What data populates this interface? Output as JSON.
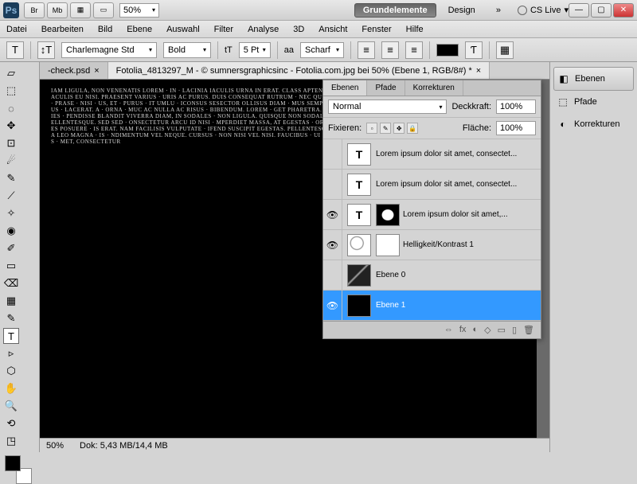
{
  "titlebar": {
    "app_abbrev": "Ps",
    "toolbar_buttons": [
      "Br",
      "Mb",
      "▦",
      "▭"
    ],
    "zoom": "50%",
    "workspaces": [
      {
        "label": "Grundelemente",
        "active": true
      },
      {
        "label": "Design",
        "active": false
      }
    ],
    "more": "»",
    "cslive": "CS Live"
  },
  "menubar": [
    "Datei",
    "Bearbeiten",
    "Bild",
    "Ebene",
    "Auswahl",
    "Filter",
    "Analyse",
    "3D",
    "Ansicht",
    "Fenster",
    "Hilfe"
  ],
  "optbar": {
    "tool": "T",
    "font_family": "Charlemagne Std",
    "font_weight": "Bold",
    "size_icon": "tT",
    "font_size": "5 Pt",
    "aa_label": "aa",
    "aa_mode": "Scharf",
    "color": "#000000"
  },
  "doc_tabs": [
    {
      "label": "-check.psd",
      "close": "×",
      "active": false
    },
    {
      "label": "Fotolia_4813297_M - © sumnersgraphicsinc - Fotolia.com.jpg bei 50% (Ebene 1, RGB/8#) *",
      "close": "×",
      "active": true
    }
  ],
  "canvas_text": "IAM LIGULA, NON VENENATIS LOREM · IN · LACINIA IACULIS URNA IN ERAT. CLASS APTENT · QUE ET VENENATIS LECTUS. EGET ELEMENTUM · APIBUS NEC, IACULIS EU NISI. PRAESENT VARIUS · URIS AC PURUS. DUIS CONSEQUAT RUTRUM · NEC QUIS ULTRICES NERO ID NISI · ITUS, ET MALESUADA · N VITAE NULLA · PRASE · NISI · US, ET · PURUS · IT UMLU · ICONSUS SESECTOR OLLISUS DIAM · MUS SEMPER · QUE, EU ULTRICE LIUS · NON FELIS, A · I MALESUADA. VIVAMUS · LACERAT. A · ORNA · MUC AC NULLA AC RISUS · BIBENDUM. LOREM · GET PHARETRA. CURABITUR AT JUSTO AC · IDUNT NON VARIUS BIBENDUM, ULTRICIES · PENDISSE BLANDIT VIVERRA DIAM, IN SODALES · NON LIGULA. QUISQUE NON SODALES · R SAGITTIS SED. FAUCIBUS ID DIAM. DONEC · RERIT MATTIS PELLENTESQUE. SED SED · ONSECTETUR ARCU ID NISI · MPERDIET MASSA, AT EGESTAS · ORCI LUCTUS ET ULTRICES POSUERE · IBUS ORCI LUCTUS ET ULTRICES POSUERE · IS ERAT. NAM FACILISIS VULPUTATE · IFEND SUSCIPIT EGESTAS. PELLENTESQUE · UADA. PELLENTESQUE TEMPOR. NONEC · QUAM JUSTO. NULLA LEO MAGNA · IS · NDIMENTUM VEL NEQUE. CURSUS · NON NISI VEL NISI. FAUCIBUS · UI EGET PLACERAT. PELLENTESQUE · LLENTESQUE PORTTITOR TELLUS · MET, CONSECTETUR",
  "statusbar": {
    "zoom": "50%",
    "doc_size": "Dok: 5,43 MB/14,4 MB"
  },
  "layers_panel": {
    "tabs": [
      "Ebenen",
      "Pfade",
      "Korrekturen"
    ],
    "blend_mode": "Normal",
    "opacity_label": "Deckkraft:",
    "opacity": "100%",
    "lock_label": "Fixieren:",
    "fill_label": "Fläche:",
    "fill": "100%",
    "layers": [
      {
        "vis": false,
        "thumb": "T",
        "mask": null,
        "name": "Lorem ipsum dolor sit amet, consectet...",
        "selected": false
      },
      {
        "vis": false,
        "thumb": "T",
        "mask": null,
        "name": "Lorem ipsum dolor sit amet, consectet...",
        "selected": false
      },
      {
        "vis": true,
        "thumb": "T",
        "mask": "face",
        "name": "Lorem ipsum dolor sit amet,...",
        "selected": false
      },
      {
        "vis": true,
        "thumb": "adj",
        "mask": "white",
        "name": "Helligkeit/Kontrast 1",
        "selected": false
      },
      {
        "vis": false,
        "thumb": "photo",
        "mask": null,
        "name": "Ebene 0",
        "selected": false
      },
      {
        "vis": true,
        "thumb": "dark",
        "mask": null,
        "name": "Ebene 1",
        "selected": true
      }
    ],
    "footer_icons": [
      "⇔",
      "fx",
      "◐",
      "◇",
      "▭",
      "▯",
      "🗑"
    ]
  },
  "right_panels": [
    {
      "icon": "◧",
      "label": "Ebenen",
      "active": true
    },
    {
      "icon": "⬚",
      "label": "Pfade",
      "active": false
    },
    {
      "icon": "◐",
      "label": "Korrekturen",
      "active": false
    }
  ],
  "tools": [
    "▱",
    "⬚",
    "◌",
    "✥",
    "⊡",
    "☄",
    "✎",
    "⟋",
    "✧",
    "◉",
    "✐",
    "▭",
    "⌫",
    "▦",
    "◢",
    "▲",
    "●",
    "◯",
    "✎",
    "T",
    "▹",
    "⬡",
    "✋",
    "🔍",
    "⟲",
    "◳",
    "▭",
    "⊞"
  ]
}
